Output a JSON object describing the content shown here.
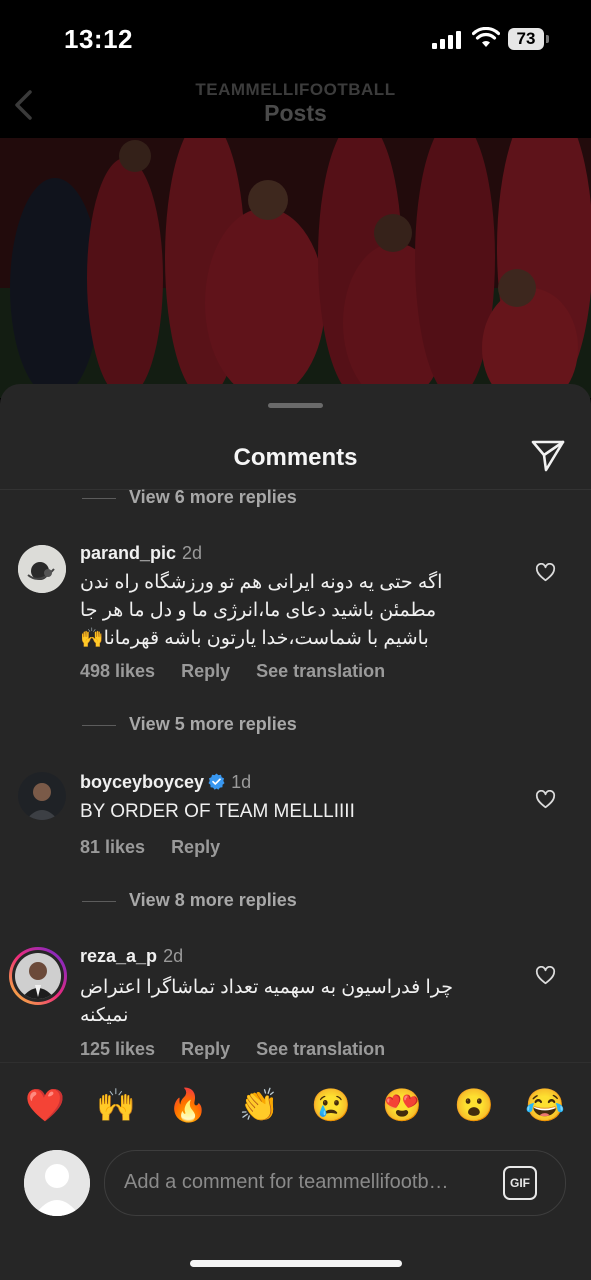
{
  "status_bar": {
    "time": "13:12",
    "battery": "73"
  },
  "nav": {
    "account": "TEAMMELLIFOOTBALL",
    "title": "Posts"
  },
  "sheet": {
    "title": "Comments"
  },
  "view_replies": [
    "View 6 more replies",
    "View 5 more replies",
    "View 8 more replies"
  ],
  "comments": [
    {
      "username": "parand_pic",
      "time": "2d",
      "text": "اگه حتی یه دونه ایرانی هم تو ورزشگاه راه ندن مطمئن باشید دعای ما،انرژی ما و دل ما هر جا باشیم با شماست،خدا یارتون باشه قهرمانا🙌",
      "likes": "498 likes",
      "reply": "Reply",
      "translate": "See translation"
    },
    {
      "username": "boyceyboycey",
      "verified": true,
      "time": "1d",
      "text": "BY ORDER OF TEAM MELLLIIII",
      "likes": "81 likes",
      "reply": "Reply"
    },
    {
      "username": "reza_a_p",
      "time": "2d",
      "text": "چرا فدراسیون به سهمیه تعداد تماشاگرا اعتراض نمیکنه",
      "likes": "125 likes",
      "reply": "Reply",
      "translate": "See translation"
    }
  ],
  "emoji_reactions": [
    "❤️",
    "🙌",
    "🔥",
    "👏",
    "😢",
    "😍",
    "😮",
    "😂"
  ],
  "composer": {
    "placeholder": "Add a comment for teammellifootb…",
    "gif_label": "GIF"
  }
}
